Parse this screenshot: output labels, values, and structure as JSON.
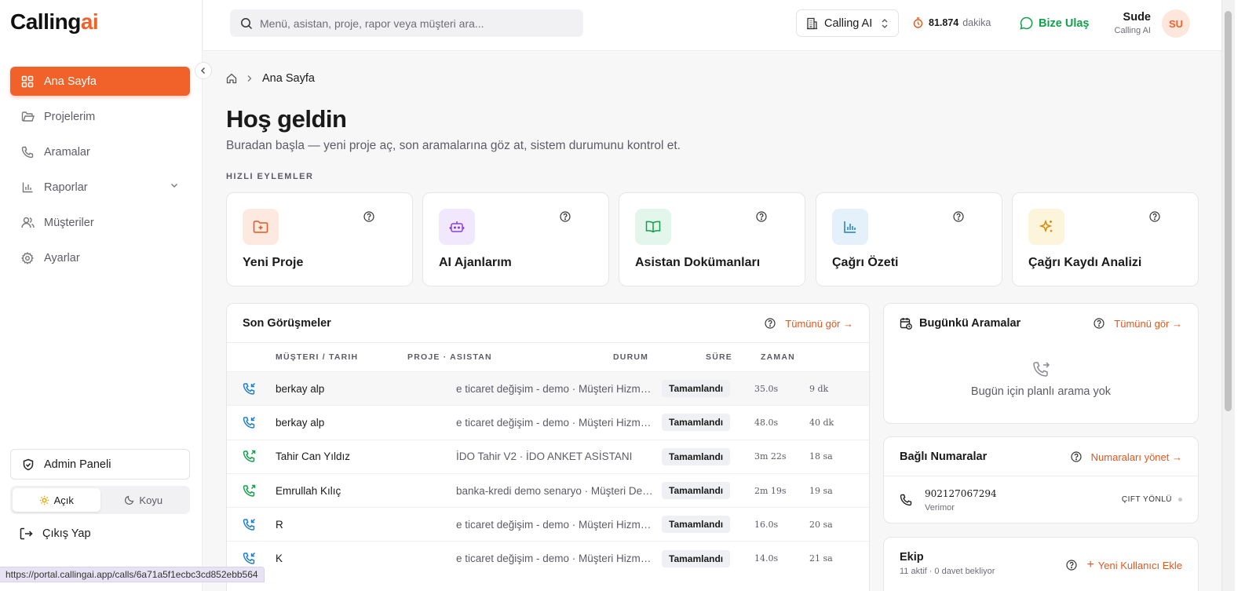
{
  "brand": {
    "logo_text_a": "Calling",
    "logo_text_b": "ai",
    "accent": "#f0622a"
  },
  "sidebar": {
    "items": [
      {
        "label": "Ana Sayfa",
        "icon": "grid-icon",
        "active": true
      },
      {
        "label": "Projelerim",
        "icon": "folder-icon"
      },
      {
        "label": "Aramalar",
        "icon": "phone-icon"
      },
      {
        "label": "Raporlar",
        "icon": "bar-chart-icon",
        "has_submenu": true
      },
      {
        "label": "Müşteriler",
        "icon": "users-icon"
      },
      {
        "label": "Ayarlar",
        "icon": "gear-icon"
      }
    ],
    "admin_label": "Admin Paneli",
    "theme_light": "Açık",
    "theme_dark": "Koyu",
    "logout_label": "Çıkış Yap"
  },
  "header": {
    "search_placeholder": "Menü, asistan, proje, rapor veya müşteri ara...",
    "org_name": "Calling AI",
    "minutes_value": "81.874",
    "minutes_unit": "dakika",
    "contact_label": "Bize Ulaş",
    "user_name": "Sude",
    "user_org": "Calling AI",
    "avatar_initials": "SU"
  },
  "breadcrumb": {
    "current": "Ana Sayfa"
  },
  "page": {
    "title": "Hoş geldin",
    "subtitle": "Buradan başla — yeni proje aç, son aramalarına göz at, sistem durumunu kontrol et.",
    "quick_actions_label": "HIZLI EYLEMLER"
  },
  "quick_actions": [
    {
      "label": "Yeni Proje",
      "icon": "folder-plus-icon",
      "bg": "#fde9df",
      "color": "#e0581e"
    },
    {
      "label": "AI Ajanlarım",
      "icon": "robot-icon",
      "bg": "#f1e8fd",
      "color": "#8b3fe0"
    },
    {
      "label": "Asistan Dokümanları",
      "icon": "book-icon",
      "bg": "#e3f6ec",
      "color": "#12a04a"
    },
    {
      "label": "Çağrı Özeti",
      "icon": "chart-icon",
      "bg": "#e4f1fb",
      "color": "#1f7fc7"
    },
    {
      "label": "Çağrı Kaydı Analizi",
      "icon": "sparkle-icon",
      "bg": "#fdf4dc",
      "color": "#d68a00"
    }
  ],
  "recent_calls": {
    "title": "Son Görüşmeler",
    "see_all": "Tümünü gör →",
    "columns": [
      "MÜŞTERI / TARIH",
      "PROJE · ASISTAN",
      "DURUM",
      "SÜRE",
      "ZAMAN"
    ],
    "rows": [
      {
        "name": "berkay alp",
        "project": "e ticaret değişim - demo · Müşteri Hizmetleri",
        "status": "Tamamlandı",
        "duration": "35.0s",
        "time": "9 dk",
        "direction": "incoming"
      },
      {
        "name": "berkay alp",
        "project": "e ticaret değişim - demo · Müşteri Hizmetleri",
        "status": "Tamamlandı",
        "duration": "48.0s",
        "time": "40 dk",
        "direction": "incoming"
      },
      {
        "name": "Tahir Can Yıldız",
        "project": "İDO Tahir V2 · İDO ANKET ASİSTANI",
        "status": "Tamamlandı",
        "duration": "3m 22s",
        "time": "18 sa",
        "direction": "outgoing"
      },
      {
        "name": "Emrullah Kılıç",
        "project": "banka-kredi demo senaryo · Müşteri Destek",
        "status": "Tamamlandı",
        "duration": "2m 19s",
        "time": "19 sa",
        "direction": "outgoing"
      },
      {
        "name": "R",
        "project": "e ticaret değişim - demo · Müşteri Hizmetleri",
        "status": "Tamamlandı",
        "duration": "16.0s",
        "time": "20 sa",
        "direction": "incoming"
      },
      {
        "name": "K",
        "project": "e ticaret değişim - demo · Müşteri Hizmetleri",
        "status": "Tamamlandı",
        "duration": "14.0s",
        "time": "21 sa",
        "direction": "incoming"
      }
    ]
  },
  "today_calls": {
    "title": "Bugünkü Aramalar",
    "see_all": "Tümünü gör →",
    "empty_text": "Bugün için planlı arama yok"
  },
  "numbers": {
    "title": "Bağlı Numaralar",
    "manage_link": "Numaraları yönet →",
    "number": "902127067294",
    "provider": "Verimor",
    "direction": "ÇIFT YÖNLÜ"
  },
  "team": {
    "title": "Ekip",
    "subtitle": "11 aktif · 0 davet bekliyor",
    "add_link": "Yeni Kullanıcı Ekle"
  },
  "status_url": "https://portal.callingai.app/calls/6a71a5f1ecbc3cd852ebb564"
}
